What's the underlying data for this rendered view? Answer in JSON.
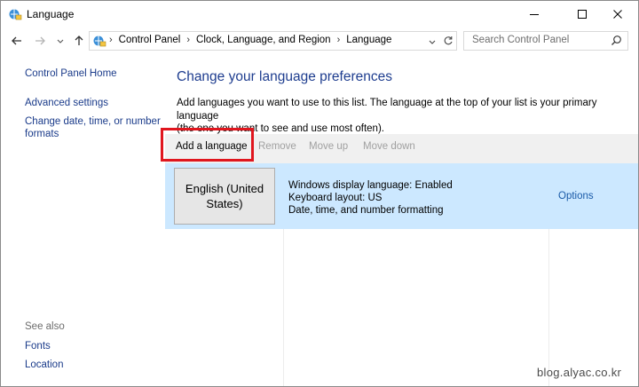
{
  "window": {
    "title": "Language"
  },
  "address": {
    "crumbs": [
      "Control Panel",
      "Clock, Language, and Region",
      "Language"
    ]
  },
  "search": {
    "placeholder": "Search Control Panel"
  },
  "sidebar": {
    "home": "Control Panel Home",
    "advanced": "Advanced settings",
    "date_line1": "Change date, time, or number",
    "date_line2": "formats",
    "see_also": "See also",
    "fonts": "Fonts",
    "location": "Location"
  },
  "main": {
    "title": "Change your language preferences",
    "desc_line1": "Add languages you want to use to this list. The language at the top of your list is your primary language",
    "desc_line2": "(the one you want to see and use most often)."
  },
  "toolbar": {
    "add": "Add a language",
    "remove": "Remove",
    "move_up": "Move up",
    "move_down": "Move down"
  },
  "languages": [
    {
      "name_line1": "English (United",
      "name_line2": "States)",
      "display": "Windows display language: Enabled",
      "keyboard": "Keyboard layout: US",
      "formatting": "Date, time, and number formatting",
      "options": "Options"
    }
  ],
  "watermark": "blog.alyac.co.kr",
  "colors": {
    "link": "#1a3b8a",
    "title": "#1e3d8f",
    "selection": "#cce8ff",
    "highlight_box": "#e0161e"
  }
}
